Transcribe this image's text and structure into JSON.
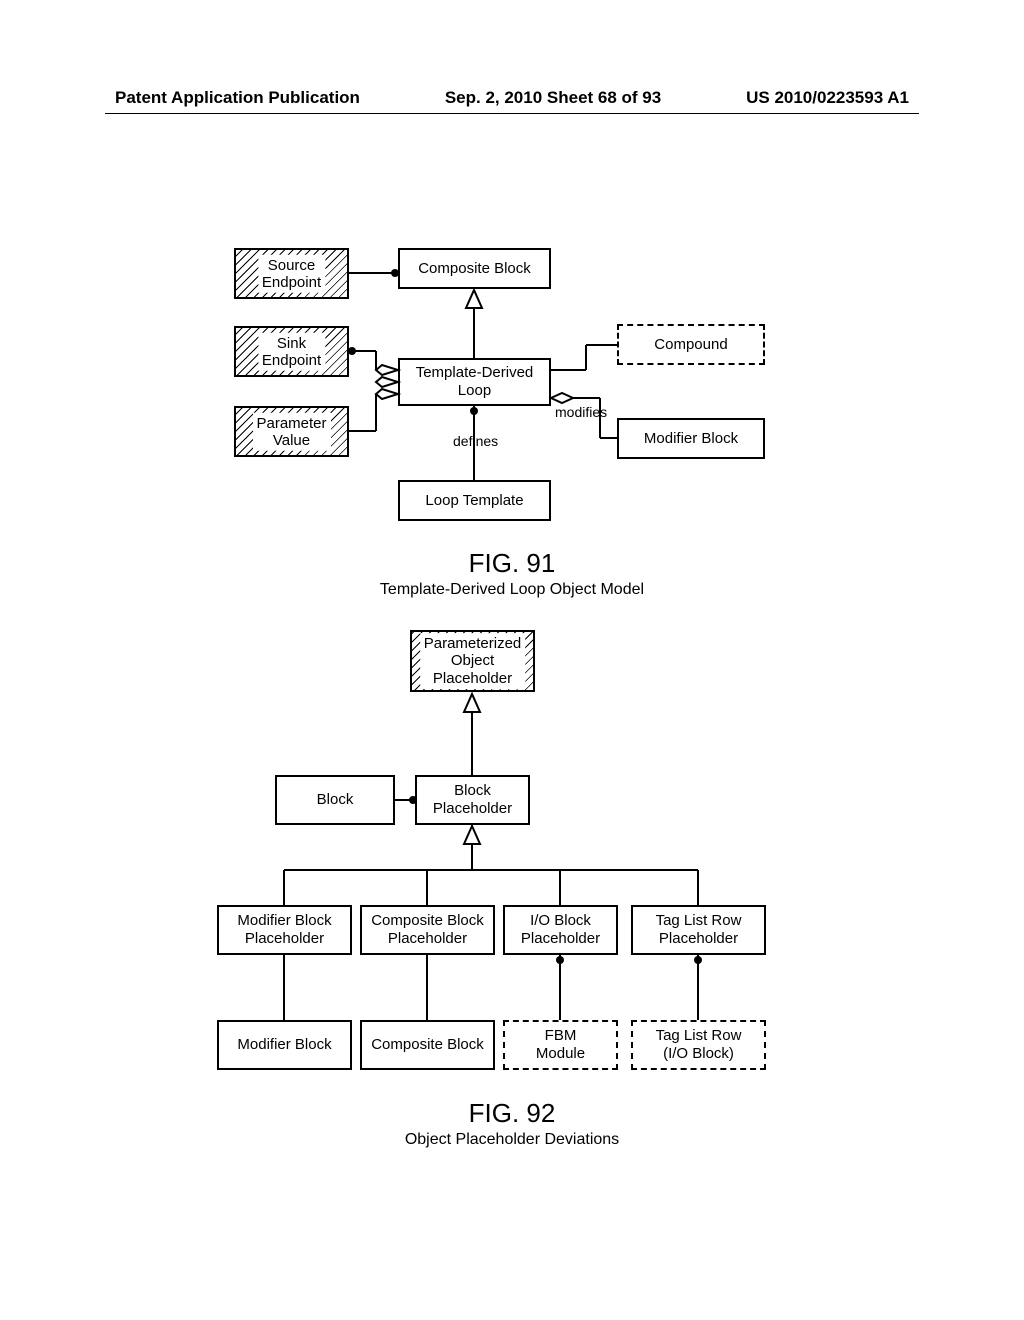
{
  "header": {
    "left": "Patent Application Publication",
    "center": "Sep. 2, 2010  Sheet 68 of 93",
    "right": "US 2010/0223593 A1"
  },
  "fig91": {
    "title": "FIG. 91",
    "caption": "Template-Derived Loop Object Model",
    "boxes": {
      "sourceEndpoint": "Source\nEndpoint",
      "sinkEndpoint": "Sink\nEndpoint",
      "parameterValue": "Parameter\nValue",
      "compositeBlock": "Composite Block",
      "templateDerivedLoop": "Template-Derived\nLoop",
      "compound": "Compound",
      "modifierBlock": "Modifier Block",
      "loopTemplate": "Loop Template",
      "defines": "defines",
      "modifies": "modifies"
    }
  },
  "fig92": {
    "title": "FIG. 92",
    "caption": "Object Placeholder Deviations",
    "boxes": {
      "parameterizedObjectPlaceholder": "Parameterized\nObject\nPlaceholder",
      "block": "Block",
      "blockPlaceholder": "Block\nPlaceholder",
      "modifierBlockPlaceholder": "Modifier Block\nPlaceholder",
      "compositeBlockPlaceholder": "Composite Block\nPlaceholder",
      "ioBlockPlaceholder": "I/O Block\nPlaceholder",
      "tagListRowPlaceholder": "Tag List Row\nPlaceholder",
      "modifierBlock": "Modifier Block",
      "compositeBlock": "Composite Block",
      "fbmModule": "FBM\nModule",
      "tagListRowIoBlock": "Tag List Row\n(I/O Block)"
    }
  }
}
